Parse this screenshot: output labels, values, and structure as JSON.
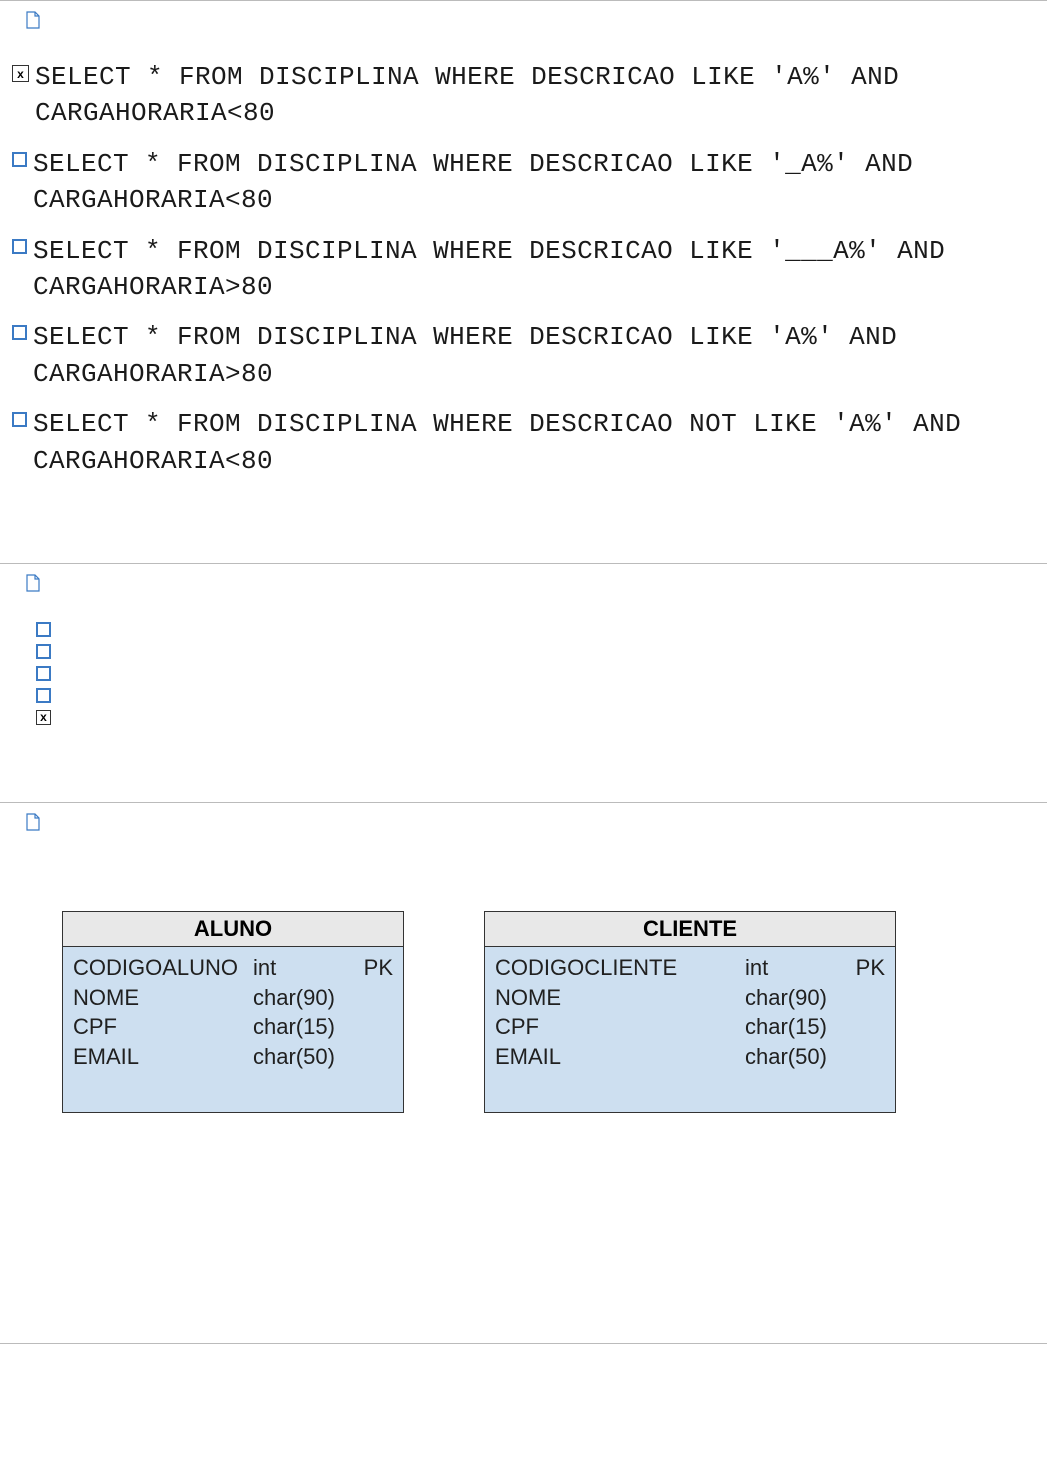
{
  "options": [
    {
      "checked": true,
      "text": "SELECT * FROM DISCIPLINA WHERE DESCRICAO LIKE 'A%' AND CARGAHORARIA<80"
    },
    {
      "checked": false,
      "text": "SELECT * FROM DISCIPLINA WHERE DESCRICAO LIKE '_A%' AND CARGAHORARIA<80"
    },
    {
      "checked": false,
      "text": "SELECT * FROM DISCIPLINA WHERE DESCRICAO LIKE '___A%' AND CARGAHORARIA>80"
    },
    {
      "checked": false,
      "text": "SELECT * FROM DISCIPLINA WHERE DESCRICAO LIKE 'A%' AND CARGAHORARIA>80"
    },
    {
      "checked": false,
      "text": "SELECT * FROM DISCIPLINA WHERE DESCRICAO NOT LIKE 'A%' AND CARGAHORARIA<80"
    }
  ],
  "choice_list": [
    {
      "checked": false
    },
    {
      "checked": false
    },
    {
      "checked": false
    },
    {
      "checked": false
    },
    {
      "checked": true
    }
  ],
  "checkbox_mark": "x",
  "tables": [
    {
      "name": "ALUNO",
      "cols": [
        {
          "name": "CODIGOALUNO",
          "type": "int",
          "key": "PK"
        },
        {
          "name": "NOME",
          "type": "char(90)",
          "key": ""
        },
        {
          "name": "CPF",
          "type": "char(15)",
          "key": ""
        },
        {
          "name": "EMAIL",
          "type": "char(50)",
          "key": ""
        }
      ]
    },
    {
      "name": "CLIENTE",
      "cols": [
        {
          "name": "CODIGOCLIENTE",
          "type": "int",
          "key": "PK"
        },
        {
          "name": "NOME",
          "type": "char(90)",
          "key": ""
        },
        {
          "name": "CPF",
          "type": "char(15)",
          "key": ""
        },
        {
          "name": "EMAIL",
          "type": "char(50)",
          "key": ""
        }
      ]
    }
  ]
}
